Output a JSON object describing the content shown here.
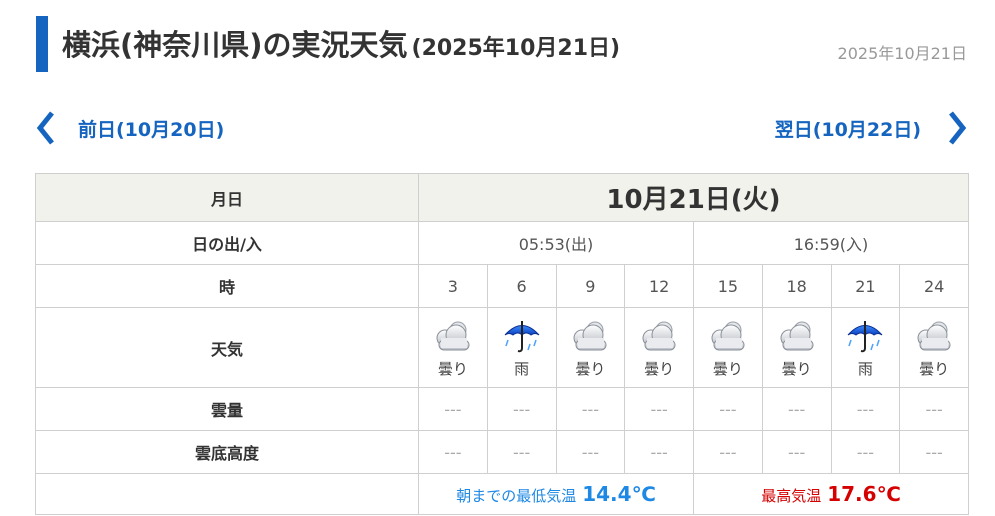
{
  "header": {
    "title": "横浜(神奈川県)の実況天気",
    "title_date": "(2025年10月21日)",
    "date": "2025年10月21日",
    "accent_color": "#1565c0"
  },
  "nav": {
    "prev_label": "前日(10月20日)",
    "next_label": "翌日(10月22日)",
    "prev_icon": "chevron-left-icon",
    "next_icon": "chevron-right-icon"
  },
  "table": {
    "row_labels": {
      "date": "月日",
      "sun": "日の出/入",
      "hour": "時",
      "weather": "天気",
      "cloud": "雲量",
      "cloud_base": "雲底高度"
    },
    "date_value": "10月21日(火)",
    "sunrise": "05:53(出)",
    "sunset": "16:59(入)",
    "hours": [
      "3",
      "6",
      "9",
      "12",
      "15",
      "18",
      "21",
      "24"
    ],
    "weather": [
      {
        "label": "曇り",
        "icon": "cloudy-icon"
      },
      {
        "label": "雨",
        "icon": "umbrella-icon"
      },
      {
        "label": "曇り",
        "icon": "cloudy-icon"
      },
      {
        "label": "曇り",
        "icon": "cloudy-icon"
      },
      {
        "label": "曇り",
        "icon": "cloudy-icon"
      },
      {
        "label": "曇り",
        "icon": "cloudy-icon"
      },
      {
        "label": "雨",
        "icon": "umbrella-icon"
      },
      {
        "label": "曇り",
        "icon": "cloudy-icon"
      }
    ],
    "cloud": [
      "---",
      "---",
      "---",
      "---",
      "---",
      "---",
      "---",
      "---"
    ],
    "cloud_base": [
      "---",
      "---",
      "---",
      "---",
      "---",
      "---",
      "---",
      "---"
    ],
    "min_temp_label": "朝までの最低気温",
    "min_temp": "14.4℃",
    "max_temp_label": "最高気温",
    "max_temp": "17.6℃",
    "min_color": "#1e88e5",
    "max_color": "#d50000"
  }
}
